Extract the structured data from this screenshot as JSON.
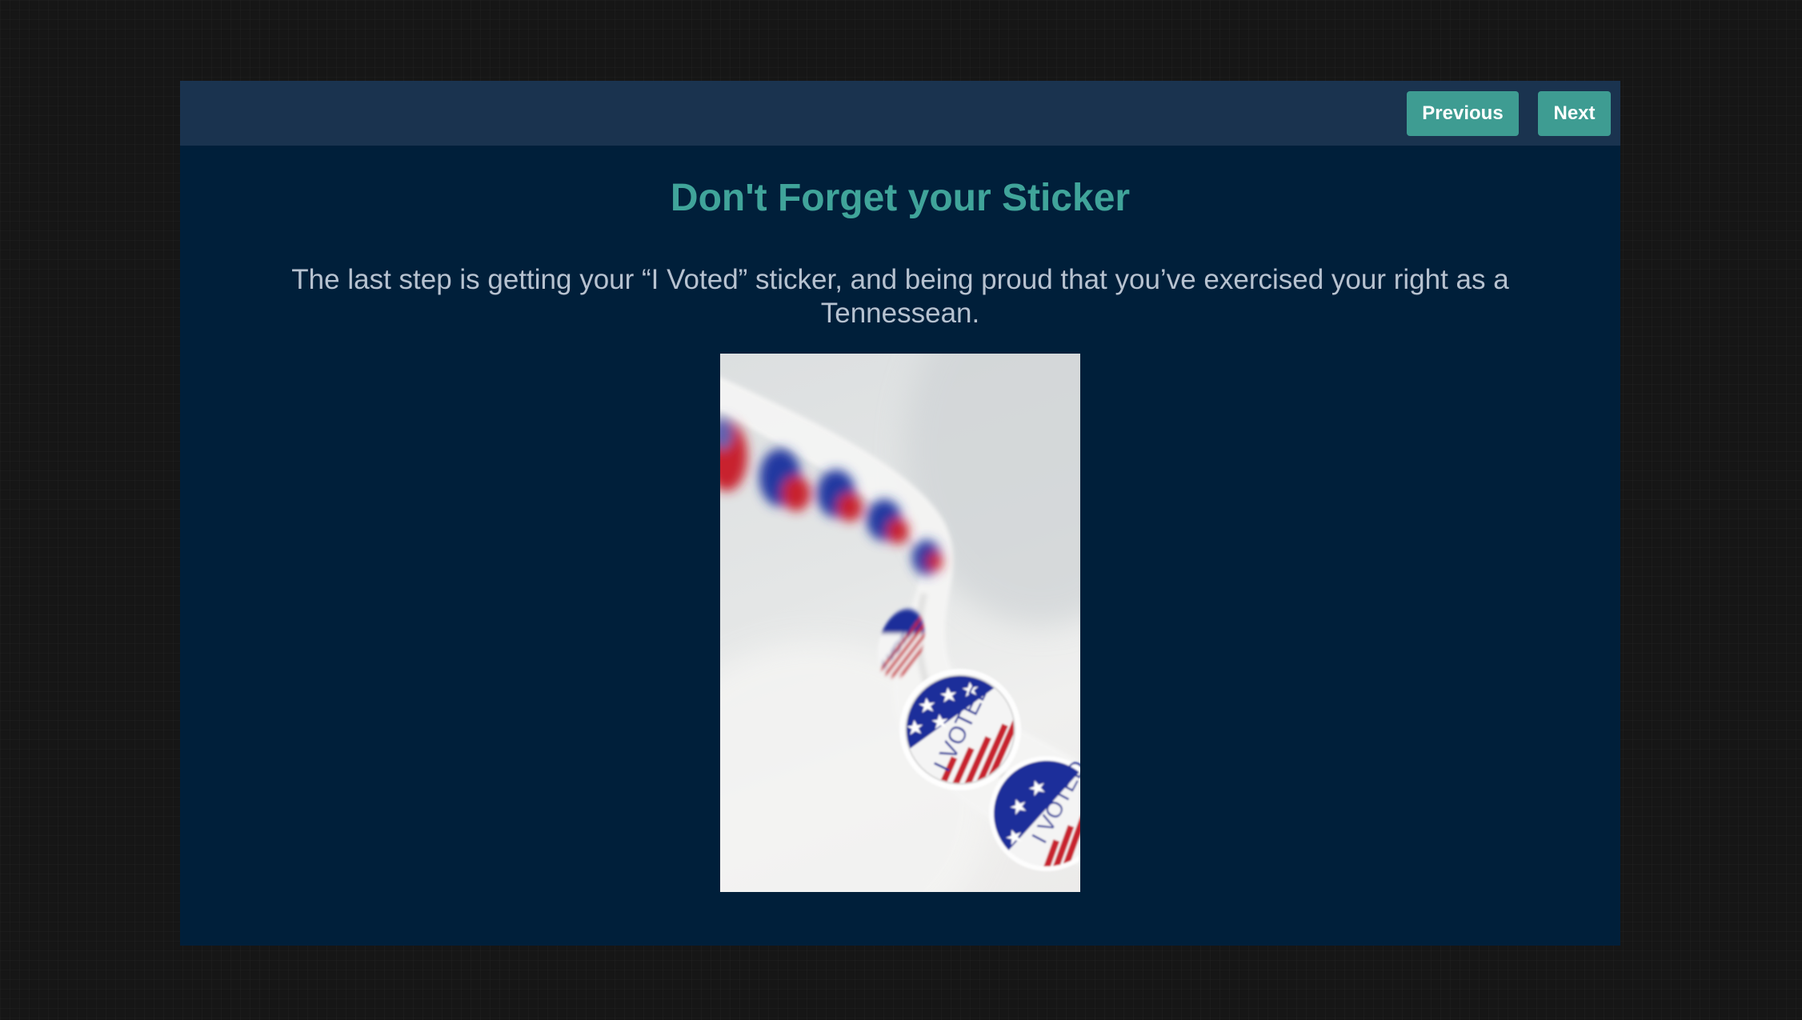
{
  "nav": {
    "previous_label": "Previous",
    "next_label": "Next"
  },
  "content": {
    "title": "Don't Forget your Sticker",
    "body": "The last step is getting your “I Voted” sticker, and being proud that you’ve exercised your right as a Tennessean."
  },
  "photo": {
    "sticker_text": "I VOTED",
    "colors": {
      "blue": "#1c2f9a",
      "red": "#c8202e",
      "white": "#f4f4f4"
    }
  },
  "colors": {
    "page_background": "#161616",
    "card_background": "#001f3a",
    "topbar_background": "#1a334f",
    "accent": "#3e9c92",
    "title": "#40a49a",
    "body_text": "#b7c2d0"
  }
}
